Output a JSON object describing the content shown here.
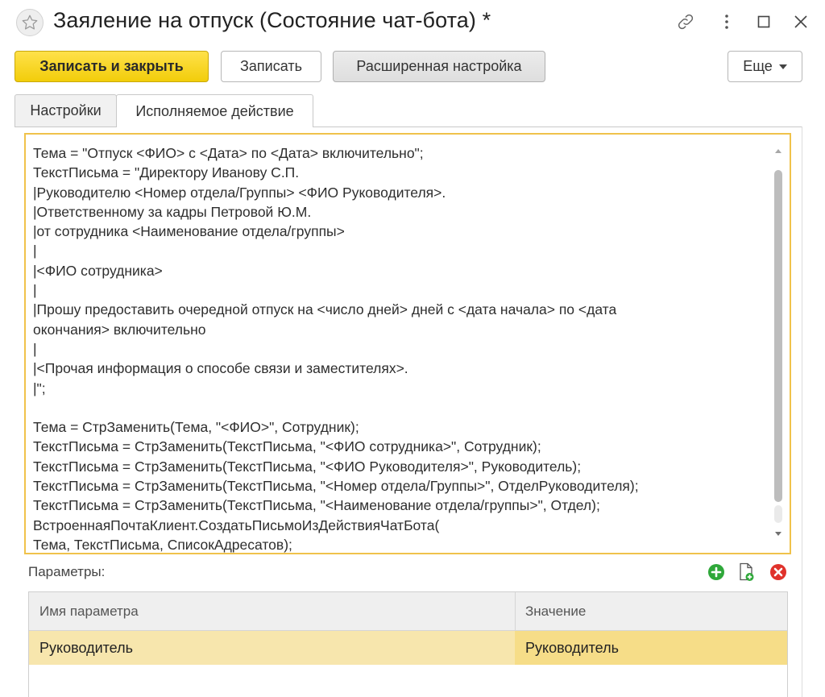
{
  "window": {
    "title": "Заяление на отпуск (Состояние чат-бота) *",
    "star_icon": "star-icon",
    "link_icon": "link-icon",
    "more_icon": "more-vertical-icon",
    "maximize_icon": "maximize-icon",
    "close_icon": "close-icon"
  },
  "toolbar": {
    "save_close_label": "Записать и закрыть",
    "save_label": "Записать",
    "advanced_label": "Расширенная настройка",
    "more_label": "Еще"
  },
  "tabs": [
    {
      "label": "Настройки",
      "active": false
    },
    {
      "label": "Исполняемое действие",
      "active": true
    }
  ],
  "code": {
    "lines": [
      "Тема = \"Отпуск <ФИО> с <Дата> по <Дата> включительно\";",
      "ТекстПисьма = \"Директору Иванову С.П.",
      "|Руководителю <Номер отдела/Группы> <ФИО Руководителя>.",
      "|Ответственному за кадры Петровой Ю.М.",
      "|от сотрудника <Наименование отдела/группы>",
      "|",
      "|<ФИО сотрудника>",
      "|",
      "|Прошу предоставить очередной отпуск на <число дней> дней с <дата начала> по <дата",
      "окончания> включительно",
      "|",
      "|<Прочая информация о способе связи и заместителях>.",
      "|\";",
      "",
      "Тема = СтрЗаменить(Тема, \"<ФИО>\", Сотрудник);",
      "ТекстПисьма = СтрЗаменить(ТекстПисьма, \"<ФИО сотрудника>\", Сотрудник);",
      "ТекстПисьма = СтрЗаменить(ТекстПисьма, \"<ФИО Руководителя>\", Руководитель);",
      "ТекстПисьма = СтрЗаменить(ТекстПисьма, \"<Номер отдела/Группы>\", ОтделРуководителя);",
      "ТекстПисьма = СтрЗаменить(ТекстПисьма, \"<Наименование отдела/группы>\", Отдел);",
      "ВстроеннаяПочтаКлиент.СоздатьПисьмоИзДействияЧатБота(",
      "Тема, ТекстПисьма, СписокАдресатов);"
    ]
  },
  "params": {
    "label": "Параметры:",
    "add_icon": "add-icon",
    "copy_icon": "copy-icon",
    "delete_icon": "delete-icon",
    "columns": [
      "Имя параметра",
      "Значение"
    ],
    "rows": [
      {
        "name": "Руководитель",
        "value": "Руководитель"
      }
    ]
  },
  "colors": {
    "primary_button": "#f5d21a",
    "editor_border": "#f0c24b",
    "selected_row": "#f7e6ad",
    "add_green": "#2fa83a",
    "delete_red": "#e0322b"
  }
}
